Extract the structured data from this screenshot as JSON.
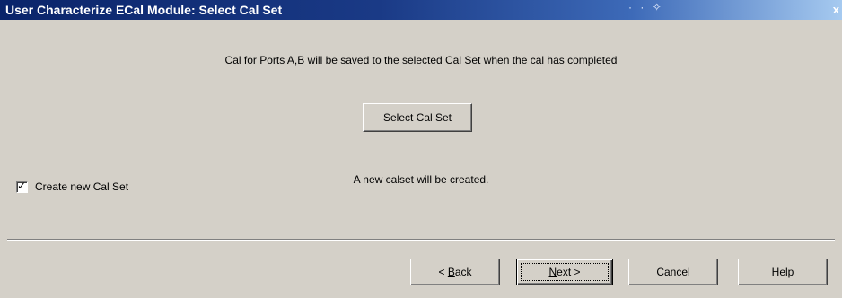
{
  "window": {
    "title": "User Characterize ECal Module: Select Cal Set",
    "close_glyph": "x"
  },
  "message": "Cal for Ports A,B will be saved to the selected Cal Set when the cal has completed",
  "select_button_label": "Select Cal Set",
  "create_checkbox": {
    "label": "Create new Cal Set",
    "checked": true
  },
  "status_text": "A new calset will be created.",
  "buttons": {
    "back_prefix": "< ",
    "back_accel": "B",
    "back_rest": "ack",
    "next_accel": "N",
    "next_rest": "ext >",
    "cancel": "Cancel",
    "help": "Help"
  }
}
